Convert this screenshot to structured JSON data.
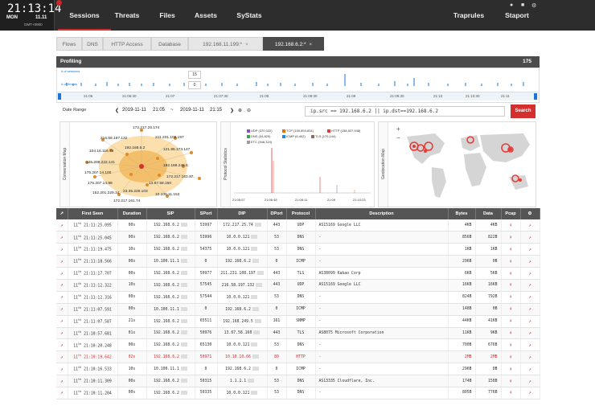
{
  "clock": {
    "time": "21:13:14",
    "day": "MON",
    "date": "11.11",
    "tz": "GMT+0900"
  },
  "nav": {
    "items": [
      "Sessions",
      "Threats",
      "Files",
      "Assets",
      "SyStats"
    ],
    "right": [
      "Traprules",
      "Staport"
    ]
  },
  "tabs": [
    {
      "label": "Flows"
    },
    {
      "label": "DNS"
    },
    {
      "label": "HTTP Access"
    },
    {
      "label": "Database"
    },
    {
      "label": "192.168.11.199:*",
      "x": "×"
    },
    {
      "label": "192.168.6.2:*",
      "x": "×"
    }
  ],
  "profiling": {
    "title": "Profiling",
    "count": "175",
    "legend1": "# of sessions",
    "legend2": "# of threats",
    "tip1": "15",
    "tip2": "0",
    "axis": [
      "21:06",
      "21:06:30",
      "21:07",
      "21:07:30",
      "21:08",
      "21:08:30",
      "21:09",
      "21:09:30",
      "21:10",
      "21:10:30",
      "21:11"
    ]
  },
  "daterange": {
    "label": "Date Range",
    "from_date": "2019-11-11",
    "from_time": "21:05",
    "sep": "~",
    "to_date": "2019-11-11",
    "to_time": "21:15",
    "query": "ip.src == 192.168.6.2 || ip.dst==192.168.6.2",
    "search": "Search"
  },
  "panels": {
    "conversation": "Conversation Map",
    "protocol": "Protocol Statistics",
    "geo": "Geolocation Map"
  },
  "convmap": [
    "172.217.25.174",
    "216.58.197.132",
    "211.231.108.197",
    "192.168.6.2",
    "104.16.116.75",
    "121.85.173.147",
    "125.209.222.141",
    "175.207.14.100",
    "172.217.161.37",
    "13.67.58.160",
    "192.168.249.5",
    "175.207.14.99",
    "152.201.229.34",
    "23.35.228.103",
    "10.100.11.153",
    "172.217.161.74"
  ],
  "protocol_legend": [
    "UDP (370,022)",
    "TCP (150,853,834)",
    "HTTP (158,827,948)",
    "DNS (34,829)",
    "ICMP (6,402)",
    "TLS (175,144)",
    "ETC (548,324)"
  ],
  "protocol_axis": [
    "21:06:07",
    "21:06:48",
    "21:08:11",
    "21:09",
    "21:10:23"
  ],
  "table": {
    "headers": [
      "First Seen",
      "Duration",
      "SIP",
      "SPort",
      "DIP",
      "DPort",
      "Protocol",
      "Description",
      "Bytes",
      "Data",
      "Pcap"
    ],
    "rows": [
      [
        "11",
        "th",
        "21:11:25.095",
        "00s",
        "192.168.6.2",
        "53997",
        "172.217.25.74",
        "443",
        "UDP",
        "AS15169 Google LLC",
        "4KB",
        "4KB"
      ],
      [
        "11",
        "th",
        "21:11:25.045",
        "00s",
        "192.168.6.2",
        "53996",
        "10.0.0.121",
        "53",
        "DNS",
        "-",
        "856B",
        "822B"
      ],
      [
        "11",
        "th",
        "21:11:19.475",
        "10s",
        "192.168.6.2",
        "54375",
        "10.0.0.121",
        "53",
        "DNS",
        "-",
        "1KB",
        "1KB"
      ],
      [
        "11",
        "th",
        "21:11:18.566",
        "00s",
        "10.100.11.1",
        "0",
        "192.168.6.2",
        "0",
        "ICMP",
        "-",
        "296B",
        "0B"
      ],
      [
        "11",
        "th",
        "21:11:17.707",
        "00s",
        "192.168.6.2",
        "50977",
        "211.231.108.197",
        "443",
        "TLS",
        "AS38099 Kakao Corp",
        "6KB",
        "5KB"
      ],
      [
        "11",
        "th",
        "21:11:12.322",
        "10s",
        "192.168.6.2",
        "57545",
        "216.58.197.132",
        "443",
        "UDP",
        "AS15169 Google LLC",
        "16KB",
        "16KB"
      ],
      [
        "11",
        "th",
        "21:11:12.316",
        "00s",
        "192.168.6.2",
        "57544",
        "10.0.0.121",
        "53",
        "DNS",
        "-",
        "824B",
        "792B"
      ],
      [
        "11",
        "th",
        "21:11:07.591",
        "00s",
        "10.100.11.1",
        "0",
        "192.168.6.2",
        "0",
        "ICMP",
        "-",
        "148B",
        "0B"
      ],
      [
        "11",
        "th",
        "21:11:07.587",
        "21s",
        "192.168.6.2",
        "65511",
        "192.168.249.5",
        "161",
        "SNMP",
        "-",
        "44KB",
        "41KB"
      ],
      [
        "11",
        "th",
        "21:10:57.681",
        "01s",
        "192.168.6.2",
        "50976",
        "13.67.58.160",
        "443",
        "TLS",
        "AS8075 Microsoft Corporation",
        "11KB",
        "9KB"
      ],
      [
        "11",
        "th",
        "21:10:20.248",
        "00s",
        "192.168.6.2",
        "65130",
        "10.0.0.121",
        "53",
        "DNS",
        "-",
        "700B",
        "676B"
      ],
      [
        "11",
        "th",
        "21:10:19.642",
        "02s",
        "192.168.6.2",
        "50971",
        "10.10.10.66",
        "80",
        "HTTP",
        "-",
        "2MB",
        "2MB"
      ],
      [
        "11",
        "th",
        "21:10:16.533",
        "10s",
        "10.100.11.1",
        "0",
        "192.168.6.2",
        "0",
        "ICMP",
        "-",
        "296B",
        "0B"
      ],
      [
        "11",
        "th",
        "21:10:11.309",
        "00s",
        "192.168.6.2",
        "50315",
        "1.1.1.1",
        "53",
        "DNS",
        "AS13335 Cloudflare, Inc.",
        "174B",
        "158B"
      ],
      [
        "11",
        "th",
        "21:10:11.204",
        "00s",
        "192.168.6.2",
        "50335",
        "10.0.0.121",
        "53",
        "DNS",
        "-",
        "805B",
        "776B"
      ]
    ]
  },
  "colors": {
    "accent": "#d32f2f",
    "header": "#555555",
    "topbar": "#2d2d2d"
  }
}
